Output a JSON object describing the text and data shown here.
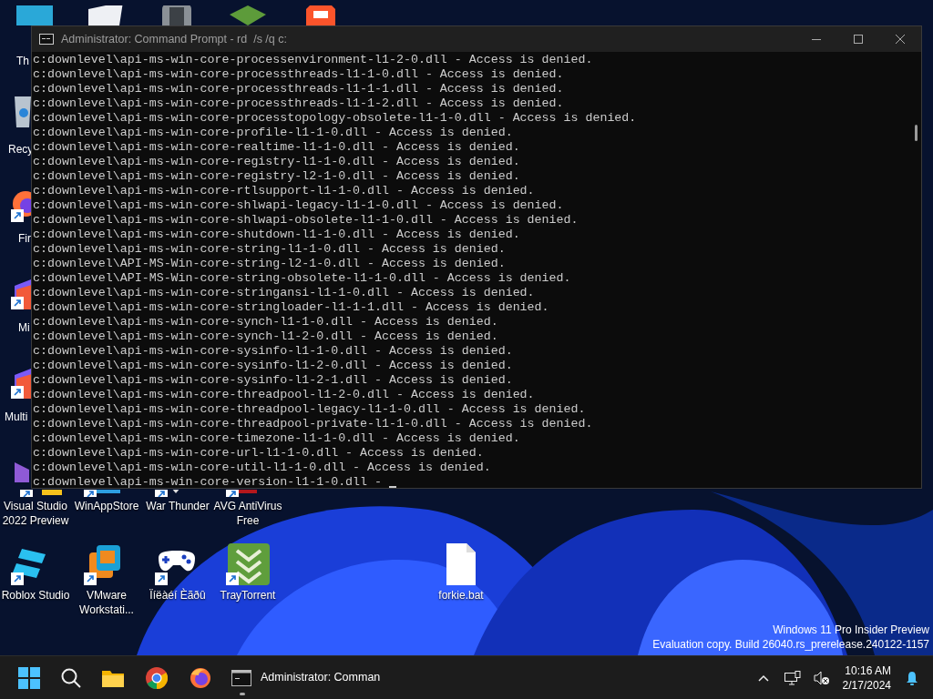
{
  "desktop": {
    "top_row_label": "Th",
    "left_labels": [
      "Recy",
      "Fir",
      "Mi",
      "Multi"
    ],
    "icons": [
      {
        "label": "Visual Studio 2022 Preview",
        "shortcut": true
      },
      {
        "label": "WinAppStore",
        "shortcut": true
      },
      {
        "label": "War Thunder",
        "shortcut": true
      },
      {
        "label": "AVG AntiVirus Free",
        "shortcut": true
      },
      {
        "label": "Roblox Studio",
        "shortcut": true
      },
      {
        "label": "VMware Workstati...",
        "shortcut": true
      },
      {
        "label": "Ïíëàéí Èãðû",
        "shortcut": true
      },
      {
        "label": "TrayTorrent",
        "shortcut": true
      },
      {
        "label": "forkie.bat",
        "shortcut": false
      }
    ]
  },
  "window": {
    "title": "Administrator: Command Prompt - rd  /s /q c:",
    "lines": [
      "c:downlevel\\api-ms-win-core-processenvironment-l1-2-0.dll - Access is denied.",
      "c:downlevel\\api-ms-win-core-processthreads-l1-1-0.dll - Access is denied.",
      "c:downlevel\\api-ms-win-core-processthreads-l1-1-1.dll - Access is denied.",
      "c:downlevel\\api-ms-win-core-processthreads-l1-1-2.dll - Access is denied.",
      "c:downlevel\\api-ms-win-core-processtopology-obsolete-l1-1-0.dll - Access is denied.",
      "c:downlevel\\api-ms-win-core-profile-l1-1-0.dll - Access is denied.",
      "c:downlevel\\api-ms-win-core-realtime-l1-1-0.dll - Access is denied.",
      "c:downlevel\\api-ms-win-core-registry-l1-1-0.dll - Access is denied.",
      "c:downlevel\\api-ms-win-core-registry-l2-1-0.dll - Access is denied.",
      "c:downlevel\\api-ms-win-core-rtlsupport-l1-1-0.dll - Access is denied.",
      "c:downlevel\\api-ms-win-core-shlwapi-legacy-l1-1-0.dll - Access is denied.",
      "c:downlevel\\api-ms-win-core-shlwapi-obsolete-l1-1-0.dll - Access is denied.",
      "c:downlevel\\api-ms-win-core-shutdown-l1-1-0.dll - Access is denied.",
      "c:downlevel\\api-ms-win-core-string-l1-1-0.dll - Access is denied.",
      "c:downlevel\\API-MS-Win-core-string-l2-1-0.dll - Access is denied.",
      "c:downlevel\\API-MS-Win-core-string-obsolete-l1-1-0.dll - Access is denied.",
      "c:downlevel\\api-ms-win-core-stringansi-l1-1-0.dll - Access is denied.",
      "c:downlevel\\api-ms-win-core-stringloader-l1-1-1.dll - Access is denied.",
      "c:downlevel\\api-ms-win-core-synch-l1-1-0.dll - Access is denied.",
      "c:downlevel\\api-ms-win-core-synch-l1-2-0.dll - Access is denied.",
      "c:downlevel\\api-ms-win-core-sysinfo-l1-1-0.dll - Access is denied.",
      "c:downlevel\\api-ms-win-core-sysinfo-l1-2-0.dll - Access is denied.",
      "c:downlevel\\api-ms-win-core-sysinfo-l1-2-1.dll - Access is denied.",
      "c:downlevel\\api-ms-win-core-threadpool-l1-2-0.dll - Access is denied.",
      "c:downlevel\\api-ms-win-core-threadpool-legacy-l1-1-0.dll - Access is denied.",
      "c:downlevel\\api-ms-win-core-threadpool-private-l1-1-0.dll - Access is denied.",
      "c:downlevel\\api-ms-win-core-timezone-l1-1-0.dll - Access is denied.",
      "c:downlevel\\api-ms-win-core-url-l1-1-0.dll - Access is denied.",
      "c:downlevel\\api-ms-win-core-util-l1-1-0.dll - Access is denied.",
      "c:downlevel\\api-ms-win-core-version-l1-1-0.dll - "
    ]
  },
  "watermark": [
    "Windows 11 Pro Insider Preview",
    "Evaluation copy. Build 26040.rs_prerelease.240122-1157"
  ],
  "taskbar": {
    "active_window": "Administrator: Comman",
    "time": "10:16 AM",
    "date": "2/17/2024"
  }
}
